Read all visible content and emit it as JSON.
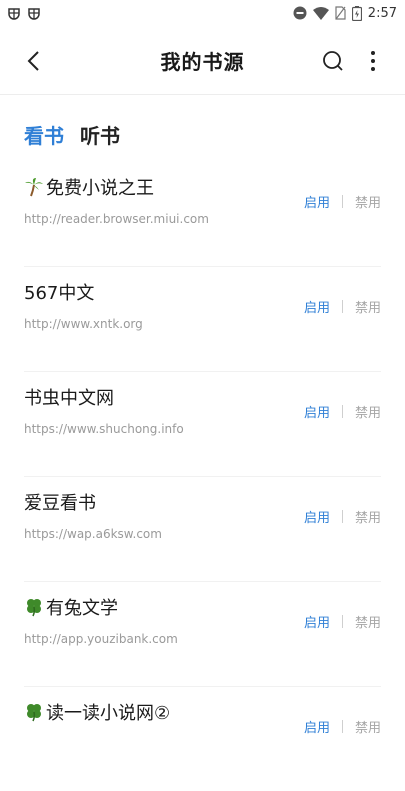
{
  "statusbar": {
    "time": "2:57"
  },
  "header": {
    "title": "我的书源"
  },
  "tabs": [
    {
      "label": "看书",
      "active": true
    },
    {
      "label": "听书",
      "active": false
    }
  ],
  "sources": [
    {
      "icon": "palm-tree-icon",
      "name": "免费小说之王",
      "url": "http://reader.browser.miui.com",
      "enable_label": "启用",
      "disable_label": "禁用"
    },
    {
      "icon": "",
      "name": "567中文",
      "url": "http://www.xntk.org",
      "enable_label": "启用",
      "disable_label": "禁用"
    },
    {
      "icon": "",
      "name": "书虫中文网",
      "url": "https://www.shuchong.info",
      "enable_label": "启用",
      "disable_label": "禁用"
    },
    {
      "icon": "",
      "name": "爱豆看书",
      "url": "https://wap.a6ksw.com",
      "enable_label": "启用",
      "disable_label": "禁用"
    },
    {
      "icon": "clover-icon",
      "name": "有兔文学",
      "url": "http://app.youzibank.com",
      "enable_label": "启用",
      "disable_label": "禁用"
    },
    {
      "icon": "clover-icon",
      "name": "读一读小说网②",
      "url": "",
      "enable_label": "启用",
      "disable_label": "禁用"
    }
  ],
  "colors": {
    "accent": "#2f7fd6",
    "muted": "#a5a5a5"
  }
}
